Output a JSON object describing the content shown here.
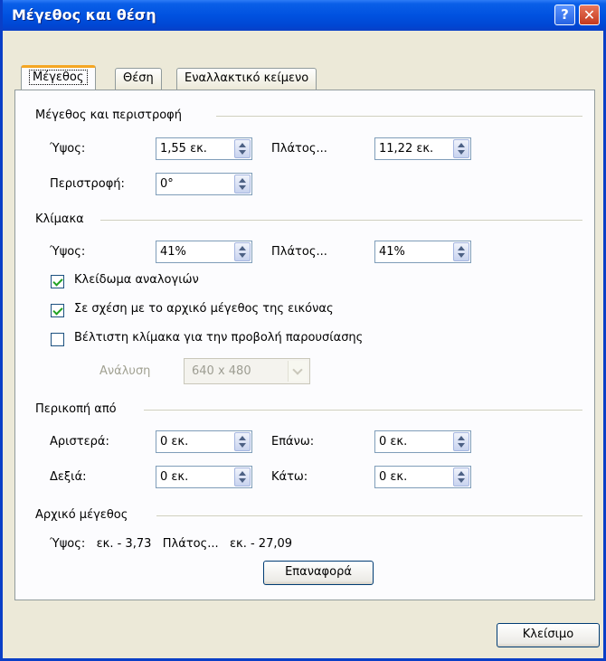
{
  "window": {
    "title": "Μέγεθος και θέση",
    "help_label": "?",
    "close_label": "✕"
  },
  "tabs": [
    {
      "label": "Μέγεθος",
      "active": true
    },
    {
      "label": "Θέση",
      "active": false
    },
    {
      "label": "Εναλλακτικό κείμενο",
      "active": false
    }
  ],
  "size_rotation": {
    "section_title": "Μέγεθος και περιστροφή",
    "height_label": "Ύψος:",
    "height_value": "1,55 εκ.",
    "width_label": "Πλάτος...",
    "width_value": "11,22 εκ.",
    "rotation_label": "Περιστροφή:",
    "rotation_value": "0°"
  },
  "scale": {
    "section_title": "Κλίμακα",
    "height_label": "Ύψος:",
    "height_value": "41%",
    "width_label": "Πλάτος...",
    "width_value": "41%",
    "lock_aspect_label": "Κλείδωμα αναλογιών",
    "lock_aspect_checked": true,
    "relative_label": "Σε σχέση με το αρχικό μέγεθος της εικόνας",
    "relative_checked": true,
    "best_scale_label": "Βέλτιστη κλίμακα για την προβολή παρουσίασης",
    "best_scale_checked": false,
    "resolution_label": "Ανάλυση",
    "resolution_value": "640 x 480"
  },
  "crop": {
    "section_title": "Περικοπή από",
    "left_label": "Αριστερά:",
    "left_value": "0 εκ.",
    "top_label": "Επάνω:",
    "top_value": "0 εκ.",
    "right_label": "Δεξιά:",
    "right_value": "0 εκ.",
    "bottom_label": "Κάτω:",
    "bottom_value": "0 εκ."
  },
  "original_size": {
    "section_title": "Αρχικό μέγεθος",
    "summary": "Ύψος:   εκ. - 3,73   Πλάτος...   εκ. - 27,09",
    "reset_label": "Επαναφορά"
  },
  "footer": {
    "close_label": "Κλείσιμο"
  }
}
